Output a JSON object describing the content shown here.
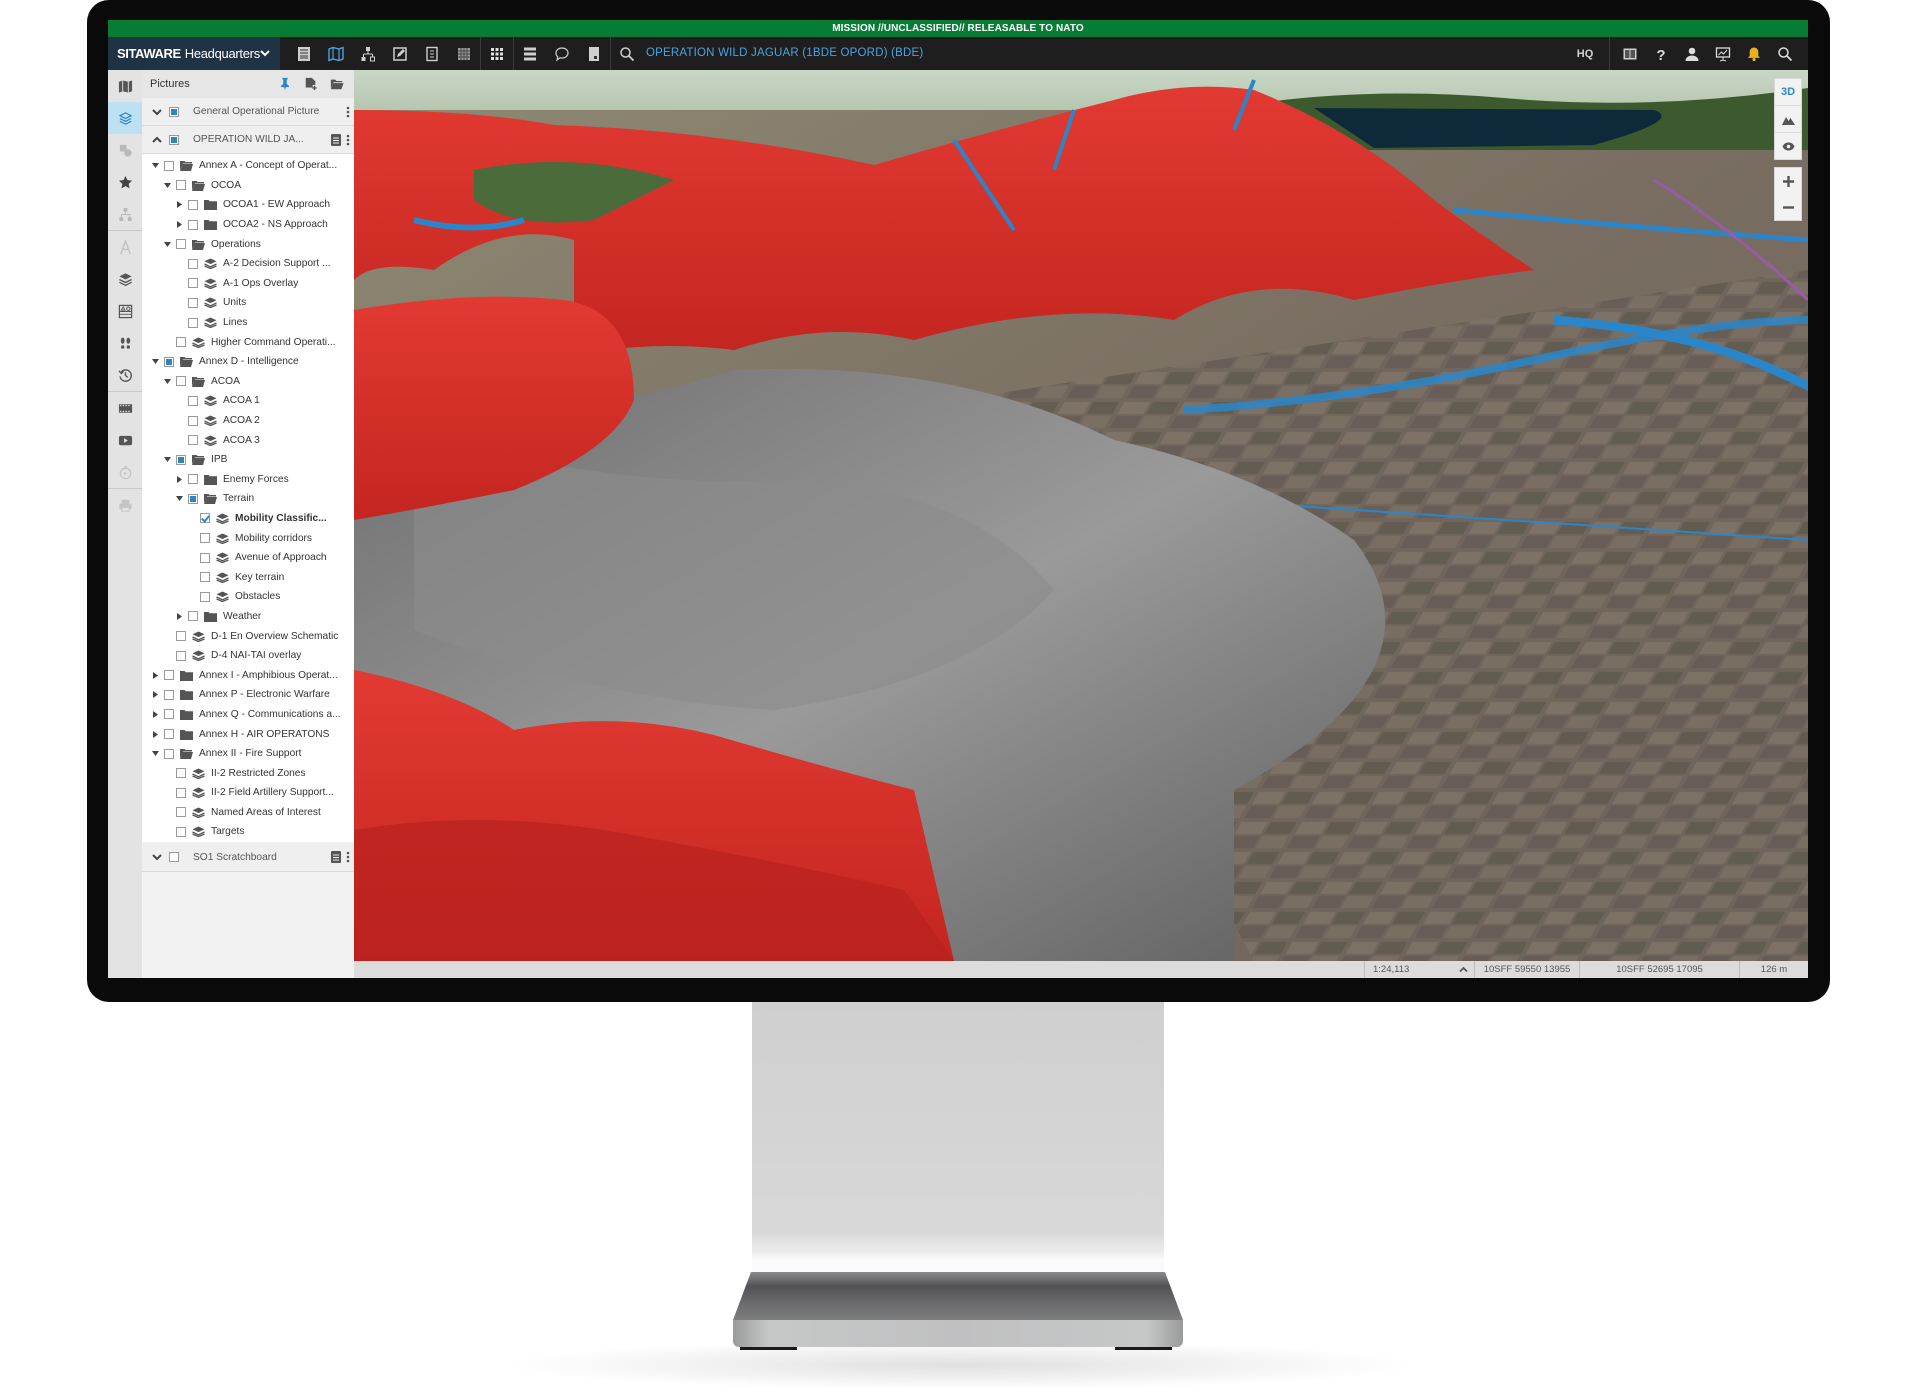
{
  "classification_banner": "MISSION //UNCLASSIFIED// RELEASABLE TO NATO",
  "app": {
    "brand_bold": "SITAWARE",
    "brand_rest": "Headquarters",
    "operation_title": "OPERATION WILD JAGUAR (1BDE OPORD) (BDE)",
    "hq_label": "HQ"
  },
  "toolbar": {
    "left_icons": [
      "document-list-icon",
      "map-icon",
      "org-chart-icon",
      "edit-icon",
      "form-icon",
      "grid-pattern-icon",
      "apps-grid-icon",
      "stack-list-icon",
      "chat-icon",
      "bookmark-icon",
      "search-icon"
    ],
    "right_icons": [
      "split-view-icon",
      "help-icon",
      "user-icon",
      "presentation-icon",
      "notification-bell-icon",
      "search-icon"
    ]
  },
  "rail": {
    "items": [
      "map-book-icon",
      "layers-icon",
      "shapes-icon",
      "favorites-star-icon",
      "hierarchy-icon",
      "text-style-icon",
      "layers-stack-icon",
      "symbol-table-icon",
      "footprints-icon",
      "history-icon",
      "filmstrip-icon",
      "video-icon",
      "timer-icon",
      "print-icon"
    ],
    "active": "layers-icon"
  },
  "panel": {
    "title": "Pictures",
    "pictures": [
      {
        "label": "General Operational Picture",
        "state": "partial",
        "expanded": false
      },
      {
        "label": "OPERATION WILD JA...",
        "state": "partial",
        "expanded": true
      }
    ],
    "tree": [
      {
        "level": 0,
        "toggle": "open",
        "state": "unchecked",
        "icon": "folder-open",
        "label": "Annex A - Concept of Operat..."
      },
      {
        "level": 1,
        "toggle": "open",
        "state": "unchecked",
        "icon": "folder-open",
        "label": "OCOA"
      },
      {
        "level": 2,
        "toggle": "closed",
        "state": "unchecked",
        "icon": "folder",
        "label": "OCOA1 - EW Approach"
      },
      {
        "level": 2,
        "toggle": "closed",
        "state": "unchecked",
        "icon": "folder",
        "label": "OCOA2 - NS Approach"
      },
      {
        "level": 1,
        "toggle": "open",
        "state": "unchecked",
        "icon": "folder-open",
        "label": "Operations"
      },
      {
        "level": 2,
        "toggle": "none",
        "state": "unchecked",
        "icon": "layer",
        "label": "A-2 Decision Support ..."
      },
      {
        "level": 2,
        "toggle": "none",
        "state": "unchecked",
        "icon": "layer",
        "label": "A-1 Ops Overlay"
      },
      {
        "level": 2,
        "toggle": "none",
        "state": "unchecked",
        "icon": "layer",
        "label": "Units"
      },
      {
        "level": 2,
        "toggle": "none",
        "state": "unchecked",
        "icon": "layer",
        "label": "Lines"
      },
      {
        "level": 1,
        "toggle": "none",
        "state": "unchecked",
        "icon": "layer",
        "label": "Higher Command Operati..."
      },
      {
        "level": 0,
        "toggle": "open",
        "state": "partial",
        "icon": "folder-open",
        "label": "Annex D - Intelligence"
      },
      {
        "level": 1,
        "toggle": "open",
        "state": "unchecked",
        "icon": "folder-open",
        "label": "ACOA"
      },
      {
        "level": 2,
        "toggle": "none",
        "state": "unchecked",
        "icon": "layer",
        "label": "ACOA 1"
      },
      {
        "level": 2,
        "toggle": "none",
        "state": "unchecked",
        "icon": "layer",
        "label": "ACOA 2"
      },
      {
        "level": 2,
        "toggle": "none",
        "state": "unchecked",
        "icon": "layer",
        "label": "ACOA 3"
      },
      {
        "level": 1,
        "toggle": "open",
        "state": "partial",
        "icon": "folder-open",
        "label": "IPB"
      },
      {
        "level": 2,
        "toggle": "closed",
        "state": "unchecked",
        "icon": "folder",
        "label": "Enemy Forces"
      },
      {
        "level": 2,
        "toggle": "open",
        "state": "partial",
        "icon": "folder-open",
        "label": "Terrain"
      },
      {
        "level": 3,
        "toggle": "none",
        "state": "checked",
        "icon": "layer",
        "label": "Mobility Classific...",
        "bold": true
      },
      {
        "level": 3,
        "toggle": "none",
        "state": "unchecked",
        "icon": "layer",
        "label": "Mobility corridors"
      },
      {
        "level": 3,
        "toggle": "none",
        "state": "unchecked",
        "icon": "layer",
        "label": "Avenue of Approach"
      },
      {
        "level": 3,
        "toggle": "none",
        "state": "unchecked",
        "icon": "layer",
        "label": "Key terrain"
      },
      {
        "level": 3,
        "toggle": "none",
        "state": "unchecked",
        "icon": "layer",
        "label": "Obstacles"
      },
      {
        "level": 2,
        "toggle": "closed",
        "state": "unchecked",
        "icon": "folder",
        "label": "Weather"
      },
      {
        "level": 1,
        "toggle": "none",
        "state": "unchecked",
        "icon": "layer",
        "label": "D-1 En Overview Schematic"
      },
      {
        "level": 1,
        "toggle": "none",
        "state": "unchecked",
        "icon": "layer",
        "label": "D-4 NAI-TAI overlay"
      },
      {
        "level": 0,
        "toggle": "closed",
        "state": "unchecked",
        "icon": "folder",
        "label": "Annex I - Amphibious Operat..."
      },
      {
        "level": 0,
        "toggle": "closed",
        "state": "unchecked",
        "icon": "folder",
        "label": "Annex P - Electronic Warfare"
      },
      {
        "level": 0,
        "toggle": "closed",
        "state": "unchecked",
        "icon": "folder",
        "label": "Annex Q - Communications a..."
      },
      {
        "level": 0,
        "toggle": "closed",
        "state": "unchecked",
        "icon": "folder",
        "label": "Annex H - AIR OPERATONS"
      },
      {
        "level": 0,
        "toggle": "open",
        "state": "unchecked",
        "icon": "folder-open",
        "label": "Annex II - Fire Support"
      },
      {
        "level": 1,
        "toggle": "none",
        "state": "unchecked",
        "icon": "layer",
        "label": "II-2 Restricted Zones"
      },
      {
        "level": 1,
        "toggle": "none",
        "state": "unchecked",
        "icon": "layer",
        "label": "II-2 Field Artillery Support..."
      },
      {
        "level": 1,
        "toggle": "none",
        "state": "unchecked",
        "icon": "layer",
        "label": "Named Areas of Interest"
      },
      {
        "level": 1,
        "toggle": "none",
        "state": "unchecked",
        "icon": "layer",
        "label": "Targets"
      }
    ],
    "scratchboard": {
      "label": "SO1 Scratchboard",
      "state": "unchecked",
      "expanded": false
    }
  },
  "map": {
    "view_mode_label": "3D",
    "controls": [
      "3d-toggle",
      "terrain-icon",
      "visibility-eye-icon",
      "zoom-in-icon",
      "zoom-out-icon"
    ],
    "overlay_color": "#d92b26"
  },
  "statusbar": {
    "scale": "1:24,113",
    "coord_1": "10SFF 59550 13955",
    "coord_2": "10SFF 52695 17095",
    "distance": "126 m"
  },
  "colors": {
    "classification_green": "#087c35",
    "accent_blue": "#2c86c4",
    "operation_title_blue": "#4aa3df",
    "bell_yellow": "#e8b21c"
  }
}
